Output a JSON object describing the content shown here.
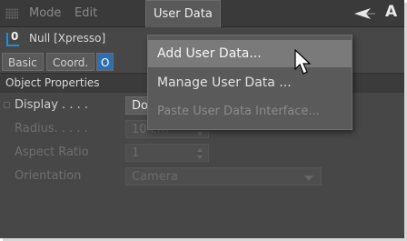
{
  "menubar": {
    "items": [
      {
        "label": "Mode"
      },
      {
        "label": "Edit"
      },
      {
        "label": "User Data"
      }
    ],
    "logo_letter": "A"
  },
  "object": {
    "icon_number": "0",
    "name": "Null [Xpresso]"
  },
  "tabs": [
    {
      "label": "Basic"
    },
    {
      "label": "Coord."
    },
    {
      "label": "O"
    }
  ],
  "section": {
    "title": "Object Properties"
  },
  "properties": [
    {
      "label": "Display . . . .",
      "value": "Dot"
    },
    {
      "label": "Radius. . . . .",
      "value": "10 cm"
    },
    {
      "label": "Aspect Ratio",
      "value": "1"
    },
    {
      "label": "Orientation",
      "value": "Camera"
    }
  ],
  "user_data_menu": {
    "items": [
      {
        "label": "Add User Data..."
      },
      {
        "label": "Manage User Data ..."
      },
      {
        "label": "Paste User Data Interface..."
      }
    ]
  },
  "colors": {
    "panel_bg": "#474747",
    "menubar_bg": "#3a3a3a",
    "menu_bg": "#5a5a5a",
    "menu_highlight": "#7a7a7a",
    "tab_selected": "#2e6fb0",
    "null_icon_blue": "#1e8fd8"
  }
}
